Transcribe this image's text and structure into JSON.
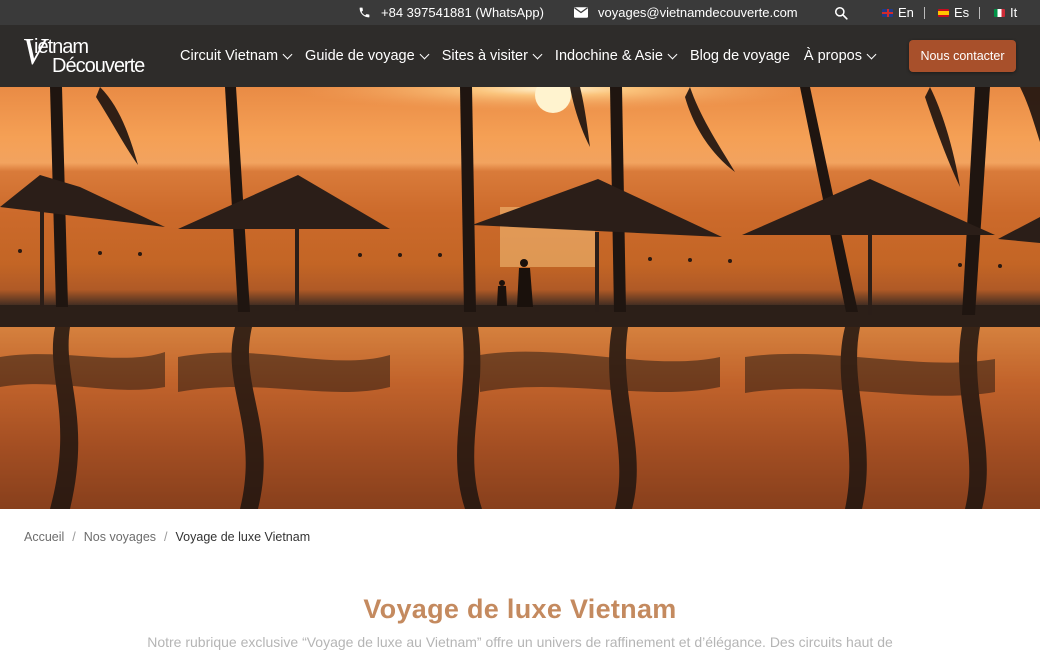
{
  "topbar": {
    "phone": "+84 397541881 (WhatsApp)",
    "email": "voyages@vietnamdecouverte.com",
    "languages": [
      {
        "code": "en",
        "label": "En"
      },
      {
        "code": "es",
        "label": "Es"
      },
      {
        "code": "it",
        "label": "It"
      }
    ],
    "icons": {
      "phone": "phone-icon",
      "email": "mail-icon",
      "search": "search-icon"
    }
  },
  "header": {
    "logo_line1": "ietnam",
    "logo_line2": "Découverte",
    "logo_initial": "V",
    "nav": [
      {
        "label": "Circuit Vietnam",
        "has_dropdown": true
      },
      {
        "label": "Guide de voyage",
        "has_dropdown": true
      },
      {
        "label": "Sites à visiter",
        "has_dropdown": true
      },
      {
        "label": "Indochine & Asie",
        "has_dropdown": true
      },
      {
        "label": "Blog de voyage",
        "has_dropdown": false
      },
      {
        "label": "À propos",
        "has_dropdown": true
      }
    ],
    "contact_label": "Nous contacter",
    "accent_color": "#a8502b"
  },
  "breadcrumb": {
    "items": [
      "Accueil",
      "Nos voyages"
    ],
    "current": "Voyage de luxe Vietnam"
  },
  "main": {
    "title": "Voyage de luxe Vietnam",
    "intro": "Notre rubrique exclusive “Voyage de luxe au Vietnam” offre un univers de raffinement et d’élégance. Des circuits haut de"
  }
}
